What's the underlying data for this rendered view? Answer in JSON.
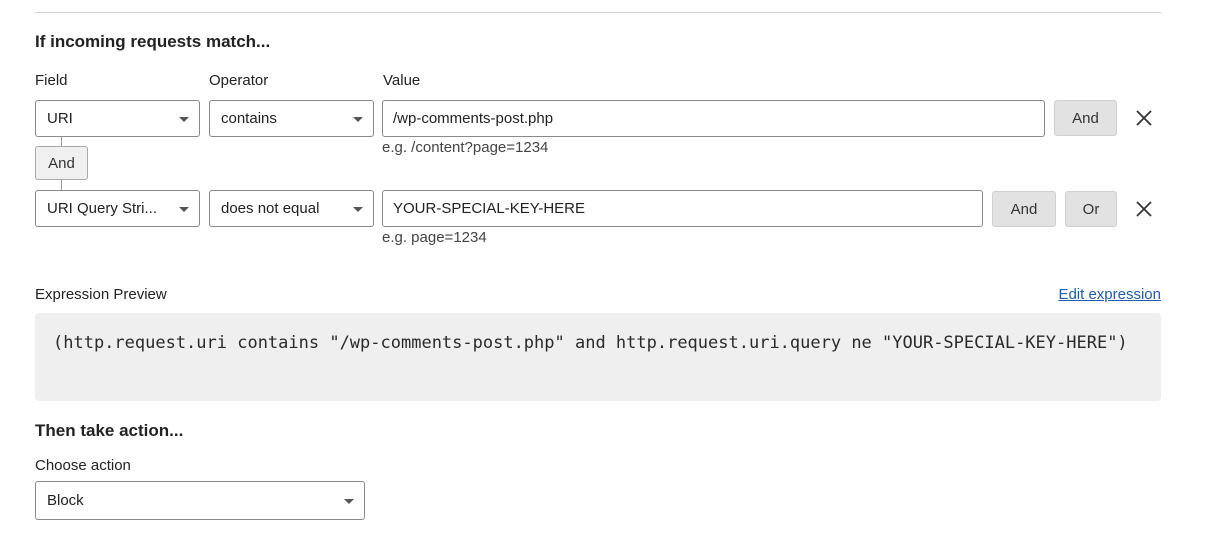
{
  "section_match": {
    "title": "If incoming requests match...",
    "column_labels": {
      "field": "Field",
      "operator": "Operator",
      "value": "Value"
    },
    "conditions": [
      {
        "field": "URI",
        "operator": "contains",
        "value": "/wp-comments-post.php",
        "hint": "e.g. /content?page=1234",
        "buttons": {
          "and": "And"
        }
      },
      {
        "field": "URI Query Stri...",
        "operator": "does not equal",
        "value": "YOUR-SPECIAL-KEY-HERE",
        "hint": "e.g. page=1234",
        "buttons": {
          "and": "And",
          "or": "Or"
        }
      }
    ],
    "connector_label": "And"
  },
  "expression": {
    "label": "Expression Preview",
    "edit_link": "Edit expression",
    "text": "(http.request.uri contains \"/wp-comments-post.php\" and http.request.uri.query ne \"YOUR-SPECIAL-KEY-HERE\")"
  },
  "section_action": {
    "title": "Then take action...",
    "choose_label": "Choose action",
    "selected": "Block"
  },
  "icons": {
    "dropdown": "caret-down-icon",
    "remove": "close-icon"
  },
  "colors": {
    "link": "#1a5fb4",
    "button_bg": "#e2e2e2",
    "code_bg": "#efefef"
  }
}
